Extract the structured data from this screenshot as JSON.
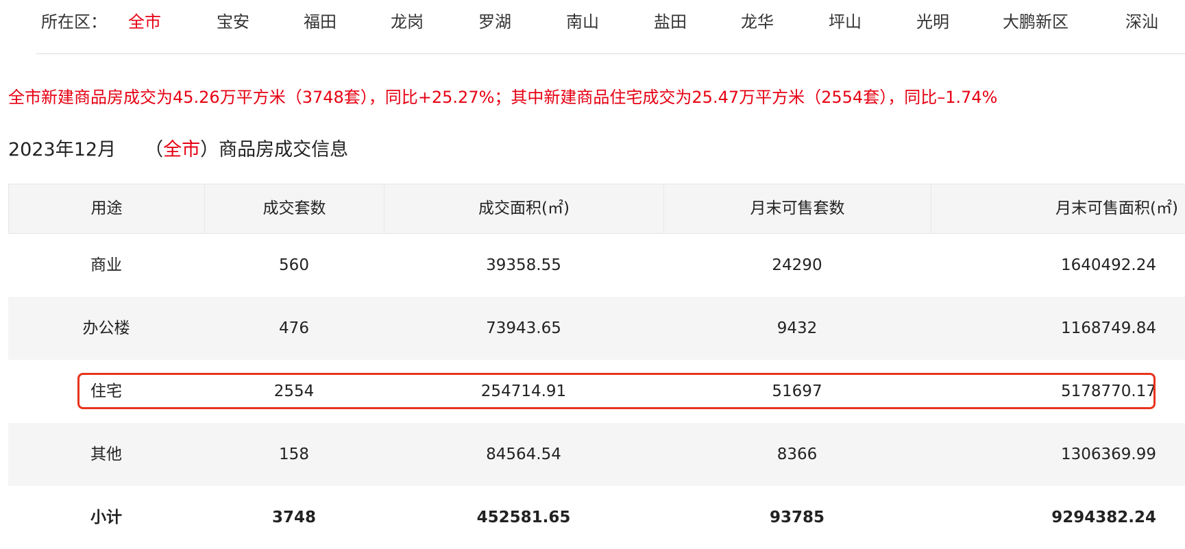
{
  "filter": {
    "label": "所在区：",
    "districts": [
      "全市",
      "宝安",
      "福田",
      "龙岗",
      "罗湖",
      "南山",
      "盐田",
      "龙华",
      "坪山",
      "光明",
      "大鹏新区",
      "深汕"
    ],
    "active": "全市"
  },
  "summary": "全市新建商品房成交为45.26万平方米（3748套），同比+25.27%；其中新建商品住宅成交为25.47万平方米（2554套），同比–1.74%",
  "section": {
    "period": "2023年12月",
    "region_open": "（",
    "region": "全市",
    "region_close": "）",
    "title": "商品房成交信息"
  },
  "table": {
    "headers": [
      "用途",
      "成交套数",
      "成交面积(㎡)",
      "月末可售套数",
      "月末可售面积(㎡)"
    ],
    "rows": [
      [
        "商业",
        "560",
        "39358.55",
        "24290",
        "1640492.24"
      ],
      [
        "办公楼",
        "476",
        "73943.65",
        "9432",
        "1168749.84"
      ],
      [
        "住宅",
        "2554",
        "254714.91",
        "51697",
        "5178770.17"
      ],
      [
        "其他",
        "158",
        "84564.54",
        "8366",
        "1306369.99"
      ],
      [
        "小计",
        "3748",
        "452581.65",
        "93785",
        "9294382.24"
      ]
    ],
    "highlighted_row": "住宅"
  },
  "colors": {
    "accent": "#e60012",
    "highlight_border": "#e8331c",
    "row_alt": "#f5f5f5"
  }
}
